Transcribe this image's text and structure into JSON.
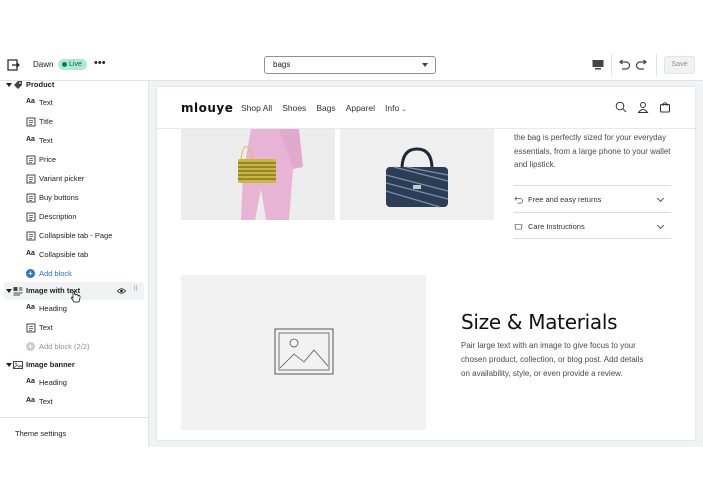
{
  "topbar": {
    "theme_name": "Dawn",
    "status_badge": "Live",
    "page_select_value": "bags",
    "save_label": "Save"
  },
  "sidebar": {
    "sections": [
      {
        "title": "Product",
        "blocks": [
          "Text",
          "Title",
          "Text",
          "Price",
          "Variant picker",
          "Buy buttons",
          "Description",
          "Collapsible tab - Page",
          "Collapsible tab"
        ],
        "add_block": "Add block"
      },
      {
        "title": "Image with text",
        "blocks": [
          "Heading",
          "Text"
        ],
        "add_block": "Add block (2/2)"
      },
      {
        "title": "Image banner",
        "blocks": [
          "Heading",
          "Text"
        ]
      }
    ],
    "theme_settings": "Theme settings"
  },
  "preview": {
    "logo": "mlouye",
    "nav": [
      "Shop All",
      "Shoes",
      "Bags",
      "Apparel",
      "Info"
    ],
    "description": "the bag is perfectly sized for your everyday essentials, from a large phone to your wallet and lipstick.",
    "accordions": [
      "Free and easy returns",
      "Care Instructions"
    ],
    "size_title": "Size & Materials",
    "size_text": "Pair large text with an image to give focus to your chosen product, collection, or blog post. Add details on availability, style, or even provide a review."
  }
}
